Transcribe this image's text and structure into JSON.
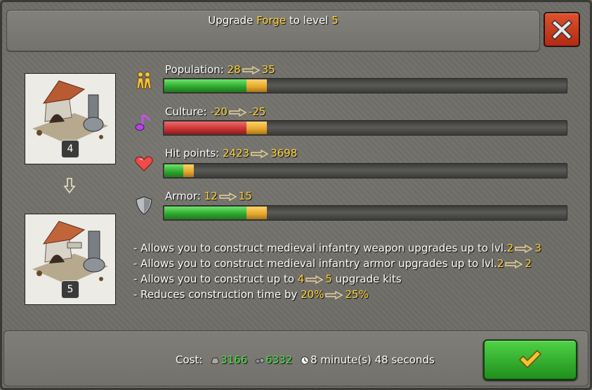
{
  "header": {
    "title_prefix": "Upgrade",
    "building": "Forge",
    "title_mid": "to level",
    "target_level": "5"
  },
  "buildings": {
    "current_level": "4",
    "next_level": "5"
  },
  "stats": [
    {
      "label": "Population:",
      "from": "28",
      "to": "35",
      "icon": "population-icon",
      "current": 0.205,
      "gain": 0.05,
      "color": "green"
    },
    {
      "label": "Culture:",
      "from": "-20",
      "to": "-25",
      "icon": "culture-note-icon",
      "current": 0.205,
      "gain": 0.05,
      "color": "red"
    },
    {
      "label": "Hit points:",
      "from": "2423",
      "to": "3698",
      "icon": "heart-icon",
      "current": 0.048,
      "gain": 0.026,
      "color": "green"
    },
    {
      "label": "Armor:",
      "from": "12",
      "to": "15",
      "icon": "shield-icon",
      "current": 0.205,
      "gain": 0.05,
      "color": "green"
    }
  ],
  "description": {
    "line1_text": "- Allows you to construct medieval infantry weapon upgrades up to lvl.",
    "line1_from": "2",
    "line1_to": "3",
    "line2_text": "- Allows you to construct medieval infantry armor upgrades up to lvl.",
    "line2_from": "2",
    "line2_to": "2",
    "line3_pre": "- Allows you to construct up to",
    "line3_from": "4",
    "line3_to": "5",
    "line3_post": "upgrade kits",
    "line4_pre": "- Reduces construction time by",
    "line4_from": "20%",
    "line4_to": "25%"
  },
  "footer": {
    "cost_label": "Cost:",
    "resource1": "3166",
    "resource2": "6332",
    "time": "8 minute(s) 48 seconds"
  },
  "colors": {
    "highlight": "#ffd33a",
    "cost_value": "#4be04a",
    "close_button": "#c8391d",
    "confirm_button": "#2fae29"
  }
}
